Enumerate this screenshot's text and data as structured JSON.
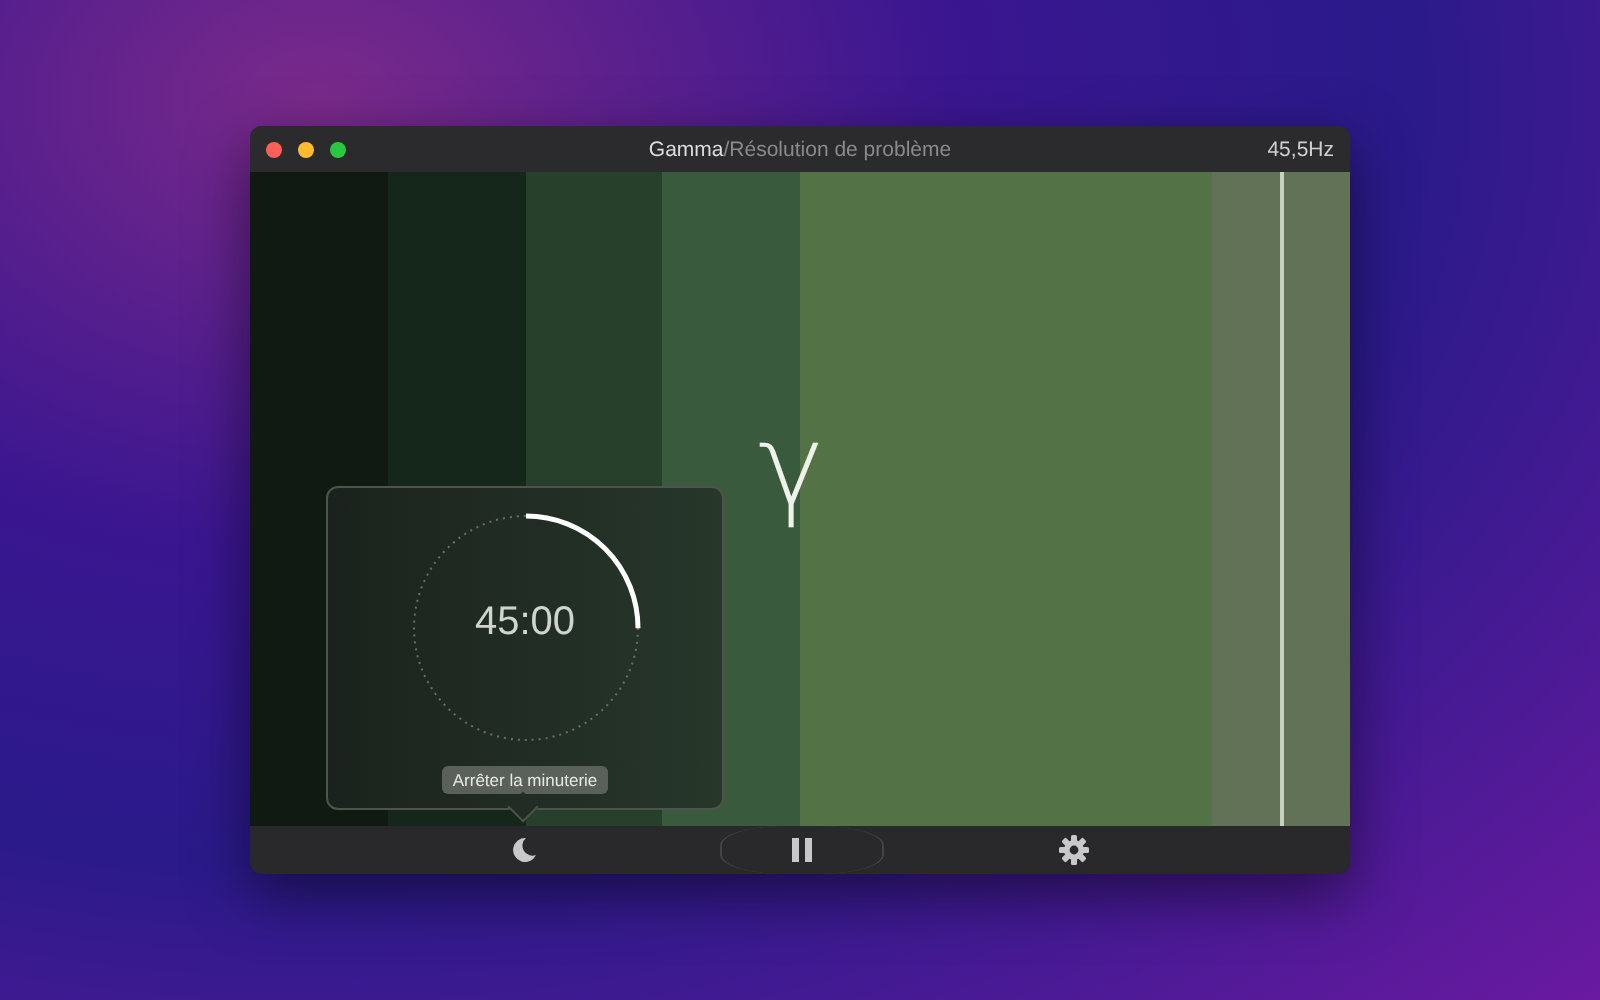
{
  "window": {
    "title": "Gamma",
    "separator": "/",
    "subtitle": "Résolution de problème",
    "frequency": "45,5Hz"
  },
  "stripes": [
    {
      "color": "#111a12"
    },
    {
      "color": "#15261a"
    },
    {
      "color": "#26402b"
    },
    {
      "color": "#3a5a3e"
    },
    {
      "color": "#537245"
    },
    {
      "color": "#537245"
    },
    {
      "color": "#537245"
    },
    {
      "color": "#627257"
    }
  ],
  "symbol": "γ",
  "timer": {
    "time": "45:00",
    "level": 0.25,
    "button": "Arrêter la minuterie"
  },
  "toolbar": {
    "playing": true
  }
}
